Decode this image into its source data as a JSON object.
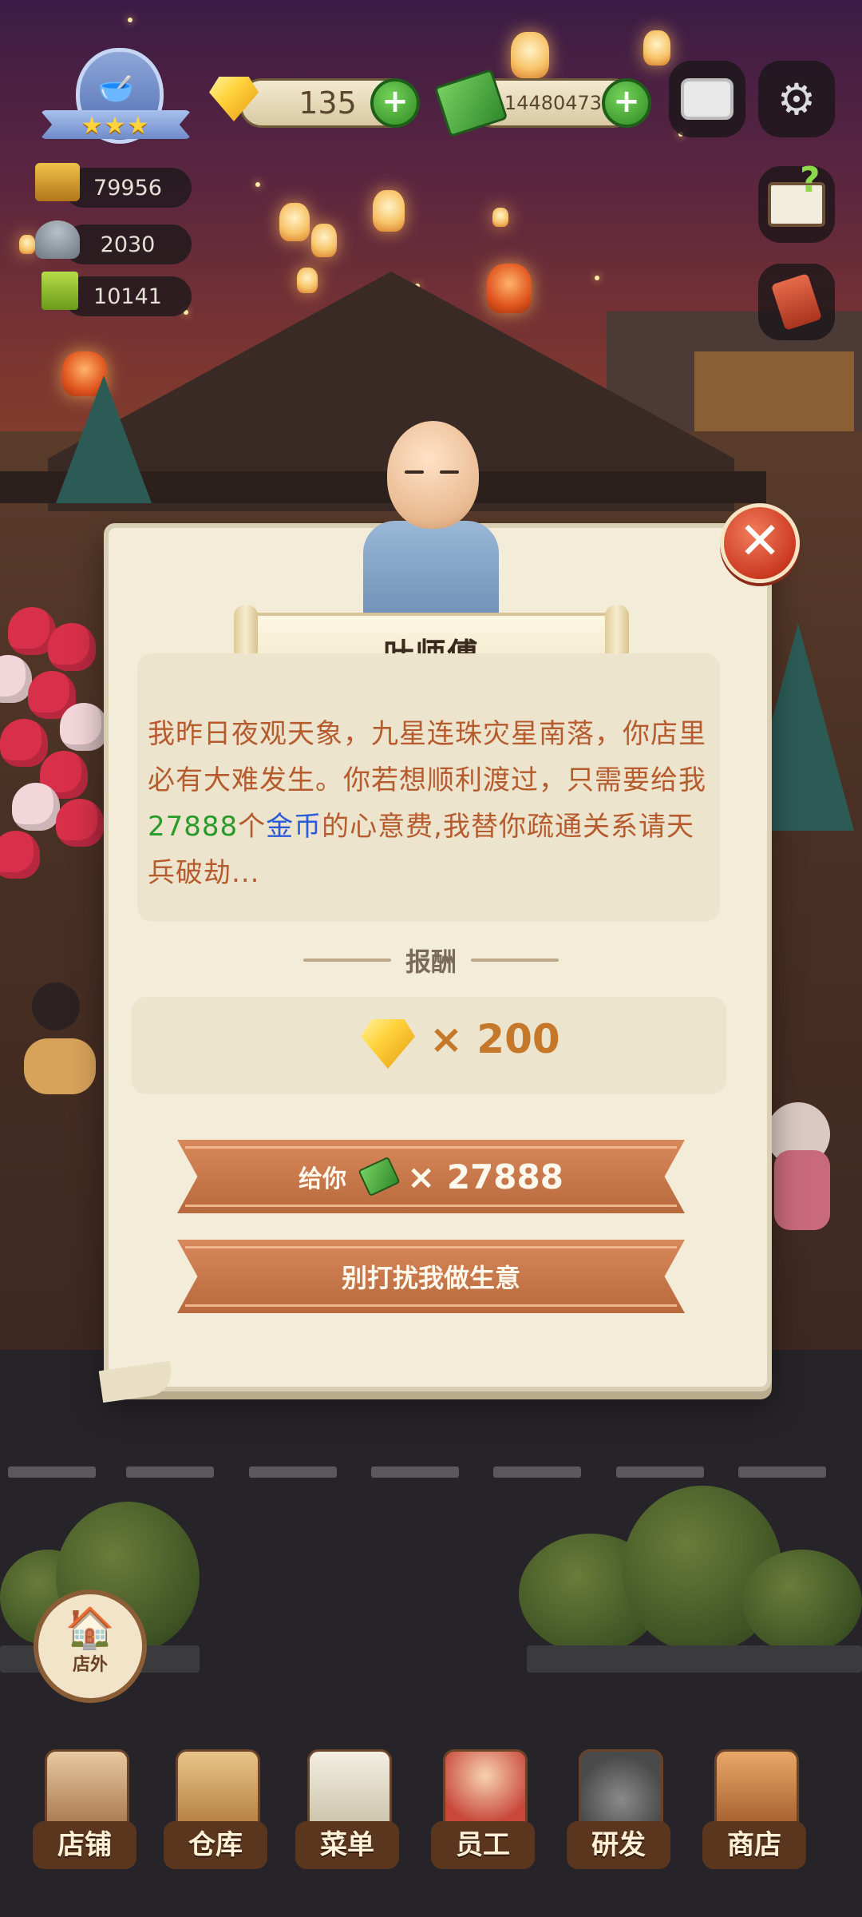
{
  "hud": {
    "gems": "135",
    "cash": "14480473",
    "stats": [
      {
        "icon": "bar-counter-icon",
        "value": "79956"
      },
      {
        "icon": "serving-dish-icon",
        "value": "2030"
      },
      {
        "icon": "green-book-icon",
        "value": "10141"
      }
    ],
    "rating_stars": "★★★"
  },
  "dialog": {
    "npc_name": "叶师傅",
    "message_part1": "我昨日夜观天象，九星连珠灾星南落，你店里必有大难发生。你若想顺利渡过，只需要给我",
    "message_amount": "27888",
    "message_part2": "个",
    "message_currency": "金币",
    "message_part3": "的心意费,我替你疏通关系请天兵破劫...",
    "reward_title": "报酬",
    "reward_value": "× 200",
    "pay_label": "给你",
    "pay_value": "× 27888",
    "decline_label": "别打扰我做生意",
    "close_symbol": "✕"
  },
  "outside_button": {
    "label": "店外"
  },
  "nav": [
    {
      "label": "店铺",
      "icon": "shop-icon"
    },
    {
      "label": "仓库",
      "icon": "warehouse-box-icon"
    },
    {
      "label": "菜单",
      "icon": "menu-clipboard-icon"
    },
    {
      "label": "员工",
      "icon": "staff-chef-icon"
    },
    {
      "label": "研发",
      "icon": "research-wok-icon"
    },
    {
      "label": "商店",
      "icon": "store-stall-icon"
    }
  ],
  "colors": {
    "message_text": "#b55b2e",
    "amount_green": "#2a9a2a",
    "currency_blue": "#2b5ad8",
    "button_ribbon": "#c97848",
    "reward_value": "#c5782a"
  }
}
